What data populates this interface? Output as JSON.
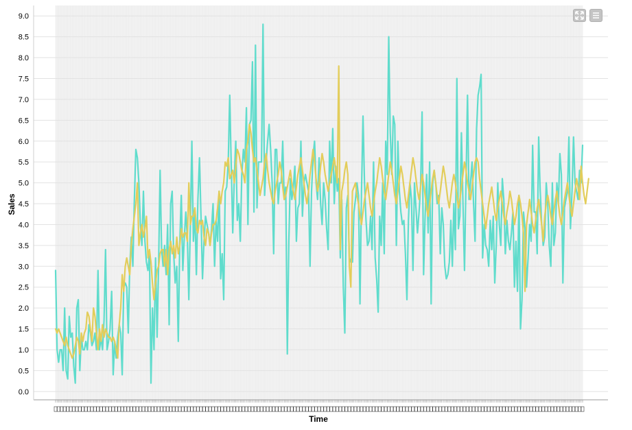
{
  "toolbar": {
    "icons": [
      "expand-icon",
      "menu-icon"
    ]
  },
  "chart_data": {
    "type": "line",
    "xlabel": "Time",
    "ylabel": "Sales",
    "ylim": [
      -0.2,
      9.25
    ],
    "yticks": [
      0.0,
      0.5,
      1.0,
      1.5,
      2.0,
      2.5,
      3.0,
      3.5,
      4.0,
      4.5,
      5.0,
      5.5,
      6.0,
      6.5,
      7.0,
      7.5,
      8.0,
      8.5,
      9.0
    ],
    "ytick_labels": [
      "0.0",
      "0.5",
      "1.0",
      "1.5",
      "2.0",
      "2.5",
      "3.0",
      "3.5",
      "4.0",
      "4.5",
      "5.0",
      "5.5",
      "6.0",
      "6.5",
      "7.0",
      "7.5",
      "8.0",
      "8.5",
      "9.0"
    ],
    "grid": true,
    "colors": {
      "actual": "#5fdccc",
      "predicted": "#e3cd5a"
    },
    "series": [
      {
        "key": "actual",
        "values": [
          2.9,
          1.0,
          0.7,
          1.0,
          1.0,
          0.5,
          2.0,
          0.5,
          0.3,
          1.8,
          1.3,
          1.4,
          0.6,
          0.2,
          2.0,
          2.2,
          0.5,
          1.3,
          1.0,
          1.0,
          1.2,
          1.0,
          1.6,
          1.4,
          1.1,
          1.2,
          1.4,
          1.0,
          2.9,
          1.0,
          1.3,
          1.0,
          1.7,
          3.4,
          1.0,
          1.2,
          1.5,
          2.4,
          0.4,
          1.2,
          0.8,
          1.3,
          1.6,
          1.4,
          0.4,
          2.5,
          2.6,
          2.5,
          1.4,
          3.0,
          3.7,
          3.0,
          4.6,
          5.8,
          5.6,
          5.0,
          4.0,
          3.5,
          4.8,
          3.6,
          3.1,
          2.9,
          3.3,
          0.2,
          2.0,
          1.0,
          3.2,
          1.3,
          3.0,
          5.3,
          3.4,
          3.0,
          3.5,
          2.8,
          4.0,
          1.6,
          4.5,
          4.8,
          3.3,
          2.6,
          3.0,
          1.2,
          3.6,
          4.7,
          2.9,
          3.7,
          4.3,
          3.7,
          2.2,
          4.0,
          6.0,
          3.6,
          4.3,
          2.8,
          4.6,
          5.6,
          4.2,
          2.7,
          3.6,
          4.2,
          4.0,
          3.8,
          3.5,
          3.9,
          4.5,
          3.0,
          4.1,
          3.6,
          4.8,
          2.7,
          3.3,
          2.2,
          4.8,
          4.9,
          5.5,
          7.1,
          5.4,
          3.8,
          5.1,
          6.0,
          4.1,
          4.5,
          3.6,
          5.2,
          5.8,
          5.5,
          6.8,
          4.0,
          6.4,
          6.5,
          7.9,
          4.3,
          8.3,
          4.4,
          5.5,
          5.5,
          5.5,
          8.8,
          4.7,
          5.5,
          6.0,
          6.4,
          5.8,
          5.0,
          3.3,
          5.8,
          5.8,
          4.5,
          5.0,
          5.0,
          6.0,
          4.6,
          4.9,
          0.9,
          3.6,
          5.1,
          4.6,
          4.9,
          5.4,
          3.6,
          4.4,
          4.5,
          6.0,
          4.2,
          5.0,
          5.2,
          5.0,
          4.8,
          3.0,
          4.8,
          5.6,
          6.0,
          5.0,
          4.6,
          5.6,
          4.5,
          4.0,
          5.0,
          4.6,
          3.9,
          3.4,
          6.0,
          5.0,
          6.3,
          4.5,
          5.4,
          4.8,
          5.1,
          3.2,
          4.6,
          2.5,
          1.4,
          4.4,
          4.7,
          3.2,
          3.1,
          3.1,
          4.3,
          4.6,
          5.0,
          4.7,
          2.1,
          4.8,
          6.6,
          5.0,
          4.1,
          3.5,
          3.6,
          4.2,
          3.4,
          5.5,
          3.2,
          2.7,
          1.9,
          4.2,
          3.5,
          5.0,
          3.3,
          6.0,
          5.2,
          8.5,
          6.2,
          5.2,
          6.6,
          6.4,
          3.5,
          6.0,
          4.8,
          4.3,
          4.0,
          4.1,
          3.3,
          2.2,
          4.1,
          5.0,
          4.6,
          2.9,
          5.0,
          4.4,
          3.8,
          4.3,
          4.9,
          6.7,
          2.8,
          4.2,
          5.2,
          3.8,
          5.5,
          2.1,
          5.0,
          5.3,
          5.0,
          4.5,
          4.7,
          3.3,
          4.4,
          4.0,
          3.0,
          2.7,
          2.8,
          3.1,
          4.1,
          3.0,
          4.5,
          3.4,
          7.5,
          3.9,
          4.2,
          6.2,
          4.5,
          2.9,
          5.0,
          7.1,
          4.6,
          5.0,
          5.5,
          4.5,
          3.6,
          6.3,
          7.1,
          7.3,
          7.6,
          3.2,
          4.0,
          3.5,
          3.4,
          3.0,
          4.1,
          3.4,
          4.2,
          2.6,
          3.5,
          5.0,
          4.0,
          3.5,
          5.1,
          4.6,
          3.3,
          4.1,
          3.6,
          3.4,
          3.8,
          4.3,
          2.5,
          3.6,
          2.4,
          4.7,
          1.5,
          2.2,
          4.3,
          3.9,
          2.5,
          3.2,
          4.0,
          3.6,
          5.9,
          4.3,
          4.3,
          3.3,
          6.1,
          4.8,
          4.0,
          3.5,
          3.7,
          5.0,
          4.5,
          3.5,
          3.0,
          5.0,
          3.5,
          3.8,
          5.0,
          4.5,
          5.7,
          5.2,
          2.6,
          4.4,
          4.6,
          4.8,
          6.1,
          3.9,
          4.8,
          6.1,
          5.0,
          4.8,
          4.6,
          5.3,
          5.0,
          5.9
        ]
      },
      {
        "key": "predicted",
        "values": [
          1.5,
          1.4,
          1.5,
          1.4,
          1.3,
          1.2,
          1.1,
          1.3,
          1.1,
          1.0,
          0.9,
          0.8,
          0.9,
          1.1,
          1.3,
          1.2,
          0.9,
          1.4,
          1.2,
          1.4,
          1.5,
          1.9,
          1.8,
          1.5,
          1.2,
          2.0,
          1.8,
          1.4,
          1.0,
          1.5,
          1.2,
          1.6,
          1.3,
          1.5,
          1.4,
          1.3,
          1.3,
          1.2,
          1.3,
          1.2,
          1.0,
          0.8,
          1.6,
          2.0,
          2.8,
          2.4,
          3.0,
          3.2,
          3.0,
          2.8,
          3.5,
          3.9,
          4.2,
          4.5,
          5.0,
          3.5,
          3.8,
          4.0,
          3.7,
          3.9,
          4.2,
          3.2,
          3.4,
          3.1,
          2.6,
          2.2,
          2.6,
          2.9,
          3.0,
          3.3,
          3.4,
          3.4,
          3.0,
          3.4,
          2.8,
          3.4,
          3.6,
          3.3,
          3.5,
          3.2,
          3.7,
          3.3,
          3.5,
          3.9,
          3.7,
          3.8,
          3.8,
          3.6,
          5.0,
          4.0,
          4.2,
          4.2,
          4.4,
          3.9,
          3.8,
          4.1,
          4.0,
          4.1,
          3.7,
          3.5,
          3.9,
          3.8,
          3.5,
          3.8,
          4.0,
          4.0,
          4.1,
          4.4,
          4.8,
          4.5,
          4.8,
          5.0,
          5.5,
          5.4,
          5.6,
          5.1,
          5.2,
          5.3,
          5.0,
          5.4,
          5.8,
          5.7,
          5.5,
          5.3,
          5.2,
          5.0,
          5.8,
          6.0,
          6.4,
          6.2,
          5.8,
          5.5,
          5.6,
          5.3,
          5.0,
          4.7,
          4.9,
          5.1,
          5.5,
          5.7,
          5.3,
          5.0,
          4.8,
          4.6,
          4.5,
          4.8,
          5.0,
          5.2,
          5.5,
          5.3,
          4.9,
          4.6,
          4.7,
          4.9,
          5.1,
          5.3,
          5.0,
          4.8,
          4.6,
          4.9,
          5.2,
          5.4,
          5.6,
          5.3,
          5.0,
          4.7,
          4.5,
          4.8,
          5.2,
          5.5,
          5.8,
          5.5,
          5.1,
          4.8,
          5.0,
          5.4,
          5.7,
          5.5,
          5.2,
          5.0,
          4.8,
          5.0,
          5.2,
          5.4,
          5.6,
          5.3,
          5.0,
          7.8,
          3.4,
          4.8,
          5.0,
          5.3,
          5.5,
          5.2,
          3.0,
          2.5,
          4.8,
          4.9,
          5.0,
          4.7,
          4.5,
          4.2,
          4.0,
          4.3,
          4.6,
          4.8,
          5.0,
          4.7,
          4.4,
          4.2,
          4.5,
          4.8,
          5.0,
          5.3,
          5.6,
          5.4,
          5.1,
          4.8,
          4.6,
          4.9,
          5.2,
          5.5,
          5.3,
          5.0,
          4.7,
          4.5,
          4.8,
          5.1,
          5.4,
          5.2,
          4.9,
          4.6,
          4.4,
          4.7,
          5.0,
          5.3,
          5.6,
          5.4,
          5.1,
          4.8,
          4.6,
          4.9,
          5.2,
          5.0,
          4.7,
          4.4,
          4.2,
          4.5,
          4.8,
          5.1,
          5.3,
          5.0,
          4.7,
          4.5,
          4.8,
          5.1,
          5.4,
          5.2,
          4.9,
          4.6,
          4.4,
          4.7,
          5.0,
          5.2,
          5.0,
          4.7,
          4.4,
          4.6,
          4.9,
          5.2,
          5.5,
          5.3,
          5.0,
          4.8,
          4.6,
          4.9,
          5.2,
          5.5,
          5.6,
          5.5,
          5.1,
          4.8,
          4.5,
          4.2,
          3.9,
          4.2,
          4.5,
          4.7,
          4.9,
          4.6,
          4.3,
          4.1,
          4.4,
          4.6,
          4.8,
          4.5,
          4.2,
          4.0,
          4.3,
          4.5,
          4.8,
          4.6,
          4.3,
          4.0,
          4.2,
          4.5,
          4.7,
          4.5,
          4.2,
          3.8,
          2.4,
          4.0,
          4.3,
          4.6,
          4.3,
          4.0,
          3.8,
          4.1,
          4.4,
          4.6,
          4.3,
          4.0,
          3.6,
          4.2,
          4.5,
          4.7,
          4.5,
          4.2,
          4.0,
          4.3,
          4.6,
          4.8,
          4.5,
          4.2,
          4.0,
          4.3,
          4.6,
          4.8,
          5.0,
          4.7,
          4.4,
          4.2,
          4.5,
          4.8,
          5.1,
          4.9,
          4.6,
          5.4,
          5.0,
          4.7,
          4.5,
          4.8,
          5.1
        ]
      }
    ]
  }
}
